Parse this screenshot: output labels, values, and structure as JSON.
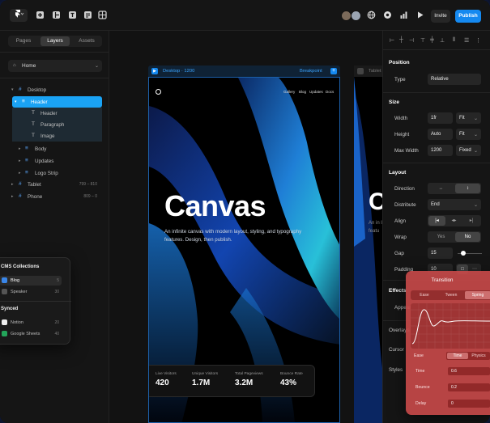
{
  "toolbar": {
    "actions": {
      "invite": "Invite",
      "publish": "Publish"
    },
    "accent_color": "#1589f0"
  },
  "left_panel": {
    "tabs": [
      "Pages",
      "Layers",
      "Assets"
    ],
    "active_tab": "Layers",
    "page_selector": "Home",
    "layers": [
      {
        "label": "Desktop",
        "icon": "frame-icon"
      },
      {
        "label": "Header",
        "icon": "stack-icon",
        "selected": true
      },
      {
        "label": "Header",
        "icon": "text-icon"
      },
      {
        "label": "Paragraph",
        "icon": "text-icon"
      },
      {
        "label": "Image",
        "icon": "text-icon"
      },
      {
        "label": "Body",
        "icon": "stack-icon"
      },
      {
        "label": "Updates",
        "icon": "stack-icon"
      },
      {
        "label": "Logo Strip",
        "icon": "stack-icon"
      },
      {
        "label": "Tablet",
        "icon": "frame-icon",
        "meta": "799 – 810"
      },
      {
        "label": "Phone",
        "icon": "frame-icon",
        "meta": "809 – 0"
      }
    ]
  },
  "collections": {
    "heading_1": "CMS Collections",
    "items_1": [
      {
        "label": "Blog",
        "count": "5"
      },
      {
        "label": "Speaker",
        "count": "30"
      }
    ],
    "heading_2": "Synced",
    "items_2": [
      {
        "label": "Notion",
        "count": "20"
      },
      {
        "label": "Google Sheets",
        "count": "40"
      }
    ]
  },
  "canvas": {
    "frame_name": "Desktop · 1200",
    "breakpoint_label": "Breakpoint",
    "tablet_label": "Tablet",
    "site": {
      "nav": [
        "Gallery",
        "Blog",
        "Updates",
        "Docs"
      ],
      "hero_title": "Canvas",
      "hero_subtitle": "An infinite canvas with modern layout, styling, and typography features. Design, then publish.",
      "stats": [
        {
          "label": "Live Visitors",
          "value": "420"
        },
        {
          "label": "Unique Visitors",
          "value": "1.7M"
        },
        {
          "label": "Total Pageviews",
          "value": "3.2M"
        },
        {
          "label": "Bounce Rate",
          "value": "43%"
        }
      ]
    },
    "tablet_site": {
      "hero_title": "C",
      "hero_subtitle": "An in layou featu"
    }
  },
  "right_panel": {
    "position": {
      "heading": "Position",
      "type_label": "Type",
      "type_value": "Relative"
    },
    "size": {
      "heading": "Size",
      "width_label": "Width",
      "width_value": "1fr",
      "width_mode": "Fit",
      "height_label": "Height",
      "height_value": "Auto",
      "height_mode": "Fit",
      "maxwidth_label": "Max Width",
      "maxwidth_value": "1200",
      "maxwidth_mode": "Fixed"
    },
    "layout": {
      "heading": "Layout",
      "direction_label": "Direction",
      "distribute_label": "Distribute",
      "distribute_value": "End",
      "align_label": "Align",
      "wrap_label": "Wrap",
      "wrap_options": [
        "Yes",
        "No"
      ],
      "wrap_value": "No",
      "gap_label": "Gap",
      "gap_value": "15",
      "padding_label": "Padding",
      "padding_value": "10"
    },
    "effects_heading": "Effects",
    "appear_label": "Appear",
    "overlays_label": "Overlays",
    "cursor_label": "Cursor",
    "styles_label": "Styles"
  },
  "transition": {
    "title": "Transition",
    "tabs": [
      "Ease",
      "Tween",
      "Spring"
    ],
    "active_tab": "Spring",
    "type_label": "Ease",
    "type_options": [
      "Time",
      "Physics"
    ],
    "rows": [
      {
        "label": "Time",
        "value": "0.6"
      },
      {
        "label": "Bounce",
        "value": "0.2"
      },
      {
        "label": "Delay",
        "value": "0"
      }
    ]
  }
}
